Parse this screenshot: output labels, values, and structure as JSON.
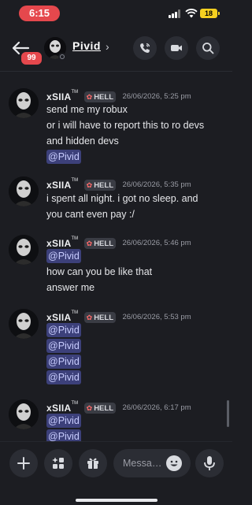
{
  "status_bar": {
    "time": "6:15",
    "battery": "18"
  },
  "header": {
    "unread_badge": "99",
    "channel_name": "Pivid",
    "chevron": "›",
    "icons": [
      "back-arrow-icon",
      "phone-icon",
      "video-icon",
      "search-icon"
    ]
  },
  "messages": [
    {
      "username": "xSIIA",
      "tm": "TM",
      "tag": "HELL",
      "timestamp": "26/06/2026, 5:25 pm",
      "lines": [
        "send me  my robux",
        "or i will have to report this to ro devs",
        "and hidden devs"
      ],
      "mentions": [
        "@Pivid"
      ]
    },
    {
      "username": "xSIIA",
      "tm": "TM",
      "tag": "HELL",
      "timestamp": "26/06/2026, 5:35 pm",
      "lines": [
        "i spent all night. i got no sleep. and",
        "you cant even pay :/"
      ],
      "mentions": []
    },
    {
      "username": "xSIIA",
      "tm": "TM",
      "tag": "HELL",
      "timestamp": "26/06/2026, 5:46 pm",
      "mentions": [
        "@Pivid"
      ],
      "lines": [
        "how can you be like that",
        "answer me"
      ]
    },
    {
      "username": "xSIIA",
      "tm": "TM",
      "tag": "HELL",
      "timestamp": "26/06/2026, 5:53 pm",
      "mentions": [
        "@Pivid",
        "@Pivid",
        "@Pivid",
        "@Pivid"
      ],
      "lines": []
    },
    {
      "username": "xSIIA",
      "tm": "TM",
      "tag": "HELL",
      "timestamp": "26/06/2026, 6:17 pm",
      "mentions": [
        "@Pivid",
        "@Pivid"
      ],
      "lines": []
    }
  ],
  "composer": {
    "placeholder": "Messa…",
    "icons": [
      "plus-icon",
      "apps-icon",
      "gift-icon",
      "emoji-icon",
      "microphone-icon"
    ]
  },
  "colors": {
    "accent_red": "#e5484d",
    "mention_bg": "#3c407a",
    "background": "#1c1d22"
  }
}
